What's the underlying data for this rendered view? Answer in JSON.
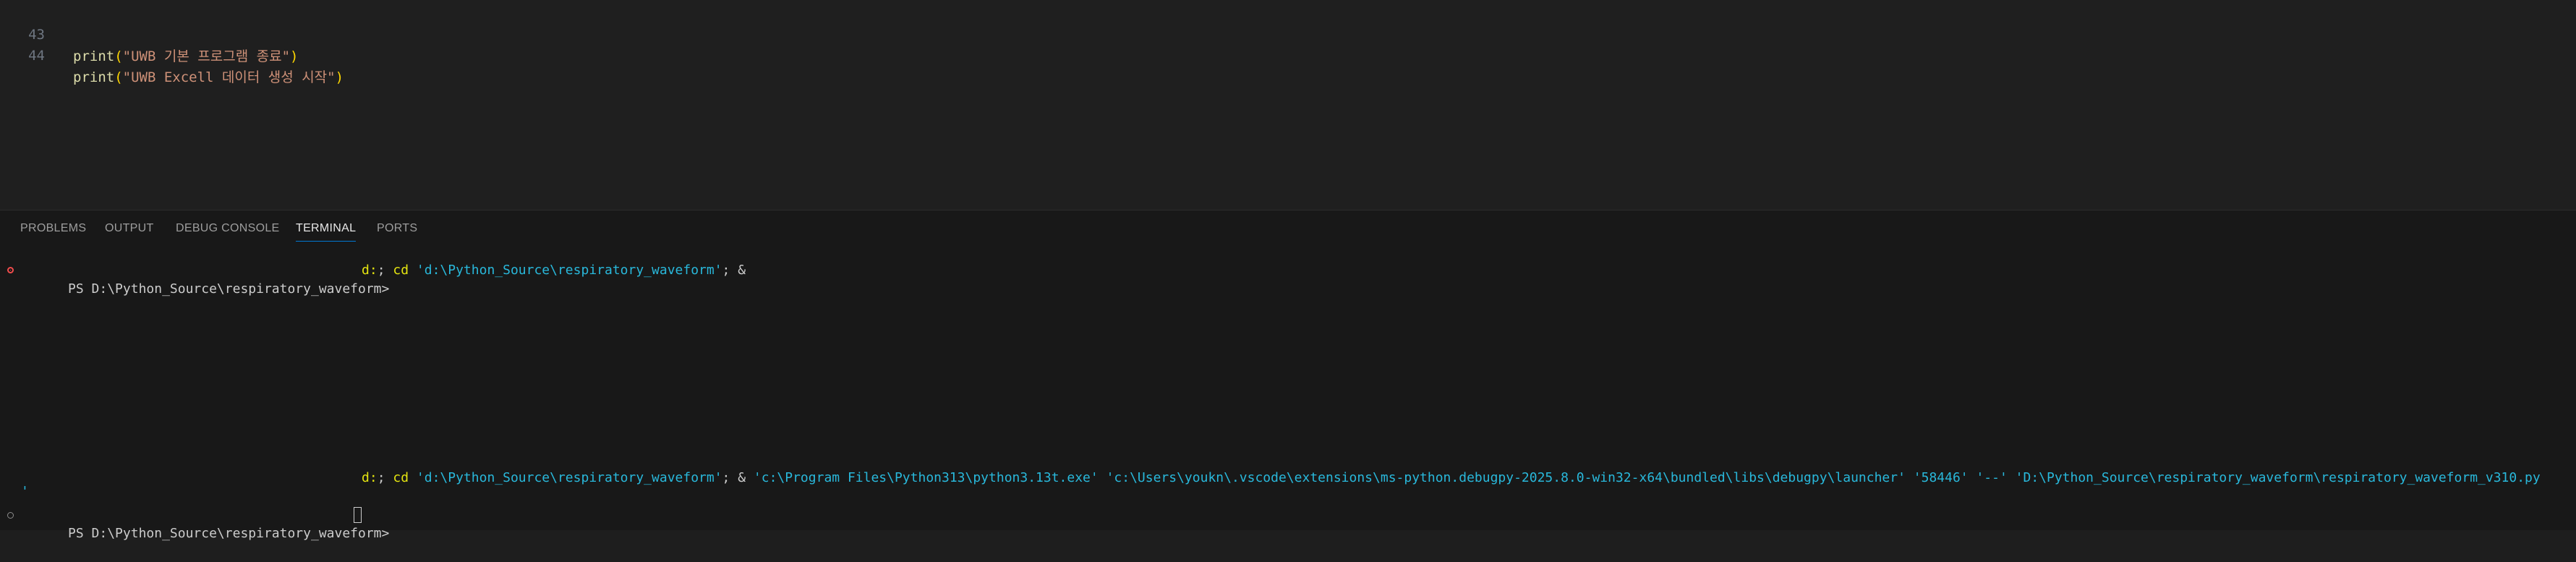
{
  "editor": {
    "lines": [
      {
        "number": "43",
        "fn": "print",
        "open": "(",
        "string": "\"UWB 기본 프로그램 종료\"",
        "close": ")"
      },
      {
        "number": "44",
        "fn": "print",
        "open": "(",
        "string": "\"UWB Excell 데이터 생성 시작\"",
        "close": ")"
      }
    ]
  },
  "panel": {
    "tabs": [
      "PROBLEMS",
      "OUTPUT",
      "DEBUG CONSOLE",
      "TERMINAL",
      "PORTS"
    ],
    "active_tab": "TERMINAL"
  },
  "terminal": {
    "line1": {
      "prompt": "PS D:\\Python_Source\\respiratory_waveform>",
      "cmd_a": "d:",
      "sep_a": "; ",
      "cmd_b": "cd",
      "arg_b": "'d:\\Python_Source\\respiratory_waveform'",
      "tail": "; &"
    },
    "line2": {
      "cmd_a": "d:",
      "sep_a": "; ",
      "cmd_b": "cd",
      "arg_b": "'d:\\Python_Source\\respiratory_waveform'",
      "sep_b": "; & ",
      "rest": "'c:\\Program Files\\Python313\\python3.13t.exe' 'c:\\Users\\youkn\\.vscode\\extensions\\ms-python.debugpy-2025.8.0-win32-x64\\bundled\\libs\\debugpy\\launcher' '58446' '--' 'D:\\Python_Source\\respiratory_waveform\\respiratory_waveform_v310.py"
    },
    "line3": "'",
    "line4": {
      "prompt": "PS D:\\Python_Source\\respiratory_waveform>"
    }
  }
}
